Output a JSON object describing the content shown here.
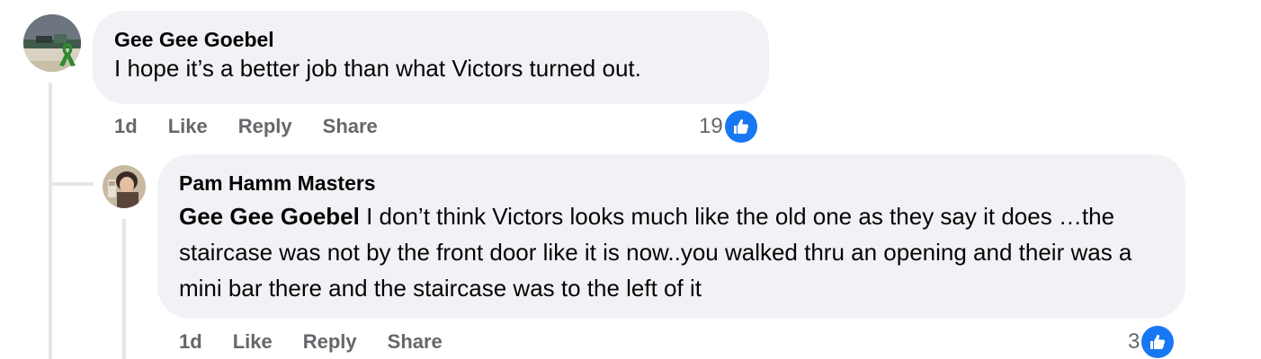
{
  "comments": [
    {
      "author": "Gee Gee Goebel",
      "text": "I hope it’s a better job than what Victors turned out.",
      "time": "1d",
      "like_label": "Like",
      "reply_label": "Reply",
      "share_label": "Share",
      "reaction_count": "19",
      "reaction_icon": "like-icon",
      "avatar": "profile photo with green ribbon badge"
    },
    {
      "author": "Pam Hamm Masters",
      "mention": "Gee Gee Goebel",
      "text": "I don’t think Victors looks much like the old one as they say it does …the staircase was not by the front door like it is now..you walked thru an opening and their was a mini bar there and the staircase was to the left of it",
      "time": "1d",
      "like_label": "Like",
      "reply_label": "Reply",
      "share_label": "Share",
      "reaction_count": "3",
      "reaction_icon": "like-icon"
    }
  ],
  "colors": {
    "bubble": "#f0f2f5",
    "action_text": "#65676b",
    "like_blue": "#1877f2",
    "thread_line": "#e4e6eb"
  }
}
